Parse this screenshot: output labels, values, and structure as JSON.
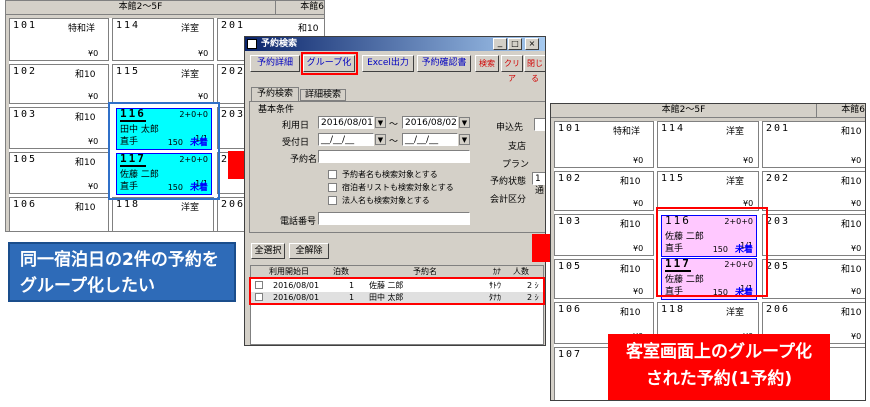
{
  "left": {
    "headers": [
      "本館2～5F",
      "本館6"
    ],
    "rooms": [
      {
        "num": "101",
        "type": "特和洋",
        "price": "¥0"
      },
      {
        "num": "114",
        "type": "洋室",
        "price": "¥0"
      },
      {
        "num": "201",
        "type": "和10",
        "price": "¥0"
      },
      {
        "num": "102",
        "type": "和10",
        "price": "¥0"
      },
      {
        "num": "115",
        "type": "洋室",
        "price": "¥0"
      },
      {
        "num": "202",
        "type": "和10",
        "price": "¥0"
      },
      {
        "num": "103",
        "type": "和10",
        "price": "¥0"
      },
      {
        "num": "203",
        "type": "和10",
        "price": "¥0"
      },
      {
        "num": "105",
        "type": "和10",
        "price": "¥0"
      },
      {
        "num": "205",
        "type": "和10",
        "price": "¥0"
      },
      {
        "num": "106",
        "type": "和10",
        "price": "¥0"
      },
      {
        "num": "118",
        "type": "洋室",
        "price": "¥0"
      },
      {
        "num": "206",
        "type": "和10",
        "price": "¥0"
      }
    ],
    "reservations": [
      {
        "num": "116",
        "occ": "2+0+0",
        "name": "田中 太郎",
        "nights": "1/1",
        "agent": "直手",
        "price": "150",
        "status": "未着"
      },
      {
        "num": "117",
        "occ": "2+0+0",
        "name": "佐藤 二郎",
        "nights": "1/1",
        "agent": "直手",
        "price": "150",
        "status": "未着"
      }
    ]
  },
  "callout_left": "同一宿泊日の2件の予約をグループ化したい",
  "dialog": {
    "title": "予約検索",
    "title_buttons": [
      "_",
      "□",
      "×"
    ],
    "toolbar": [
      "予約詳細",
      "グループ化",
      "Excel出力",
      "予約確認書",
      "検索",
      "クリア",
      "閉じる"
    ],
    "tabs": [
      "予約検索",
      "詳細検索"
    ],
    "group_label": "基本条件",
    "labels": {
      "use_date": "利用日",
      "receipt_date": "受付日",
      "res_name": "予約名",
      "phone": "電話番号",
      "tilde": "～",
      "applicant": "申込先",
      "branch": "支店",
      "plan": "プラン",
      "status": "予約状態",
      "accounting": "会計区分"
    },
    "use_date_from": "2016/08/01",
    "use_date_to": "2016/08/02",
    "receipt_date_from": "__/__/__",
    "receipt_date_to": "__/__/__",
    "status_value": "1 通",
    "checkboxes": [
      "予約者名も検索対象とする",
      "宿泊者リストも検索対象とする",
      "法人名も検索対象とする"
    ],
    "select_all": "全選択",
    "deselect_all": "全解除",
    "columns": [
      "利用開始日",
      "泊数",
      "予約名",
      "ｶﾅ",
      "人数"
    ],
    "rows": [
      {
        "date": "2016/08/01",
        "nights": "1",
        "name": "佐藤 二郎",
        "kana": "ｻﾄｳ",
        "people": "2 ｼ"
      },
      {
        "date": "2016/08/01",
        "nights": "1",
        "name": "田中 太郎",
        "kana": "ﾀﾅｶ",
        "people": "2 ｼ"
      }
    ]
  },
  "right": {
    "headers": [
      "本館2～5F",
      "本館6"
    ],
    "rooms": [
      {
        "num": "101",
        "type": "特和洋",
        "price": "¥0"
      },
      {
        "num": "114",
        "type": "洋室",
        "price": "¥0"
      },
      {
        "num": "201",
        "type": "和10",
        "price": "¥0"
      },
      {
        "num": "102",
        "type": "和10",
        "price": "¥0"
      },
      {
        "num": "115",
        "type": "洋室",
        "price": "¥0"
      },
      {
        "num": "202",
        "type": "和10",
        "price": "¥0"
      },
      {
        "num": "103",
        "type": "和10",
        "price": "¥0"
      },
      {
        "num": "203",
        "type": "和10",
        "price": "¥0"
      },
      {
        "num": "105",
        "type": "和10",
        "price": "¥0"
      },
      {
        "num": "205",
        "type": "和10",
        "price": "¥0"
      },
      {
        "num": "106",
        "type": "和10",
        "price": "¥0"
      },
      {
        "num": "118",
        "type": "洋室",
        "price": "¥0"
      },
      {
        "num": "206",
        "type": "和10",
        "price": "¥0"
      },
      {
        "num": "107",
        "type": "和10",
        "price": "¥0"
      }
    ],
    "reservations": [
      {
        "num": "116",
        "occ": "2+0+0",
        "name": "佐藤 二郎",
        "nights": "1/1",
        "agent": "直手",
        "price": "150",
        "status": "未着"
      },
      {
        "num": "117",
        "occ": "2+0+0",
        "name": "佐藤 二郎",
        "nights": "1/1",
        "agent": "直手",
        "price": "150",
        "status": "未着"
      }
    ]
  },
  "callout_right": "客室画面上のグループ化された予約(1予約)",
  "colors": {
    "cyan": "#00ffff",
    "pink": "#ffc8ff",
    "red": "#ff0000",
    "blue_box": "#3070c8",
    "title_bar": "#0a246a"
  }
}
